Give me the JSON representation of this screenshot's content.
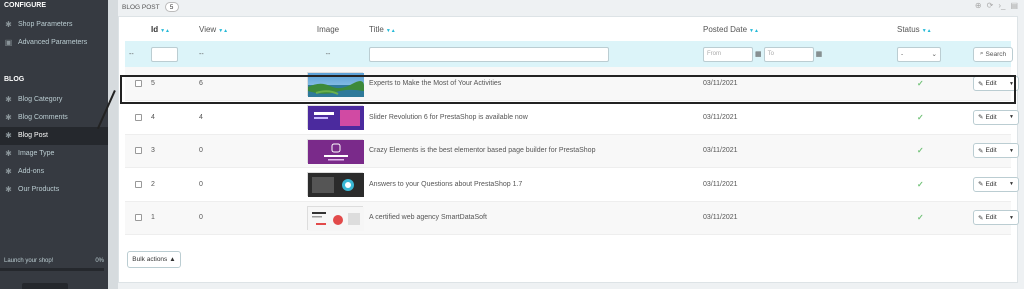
{
  "sidebar": {
    "configure_title": "CONFIGURE",
    "configure_items": [
      {
        "label": "Shop Parameters",
        "icon": "gear-icon"
      },
      {
        "label": "Advanced Parameters",
        "icon": "settings-box-icon"
      }
    ],
    "blog_title": "BLOG",
    "blog_items": [
      {
        "label": "Blog Category",
        "icon": "puzzle-icon"
      },
      {
        "label": "Blog Comments",
        "icon": "puzzle-icon"
      },
      {
        "label": "Blog Post",
        "icon": "puzzle-icon",
        "active": true
      },
      {
        "label": "Image Type",
        "icon": "puzzle-icon"
      },
      {
        "label": "Add-ons",
        "icon": "puzzle-icon"
      },
      {
        "label": "Our Products",
        "icon": "puzzle-icon"
      }
    ],
    "launch_label": "Launch your shop!",
    "launch_progress": "0%"
  },
  "panel": {
    "title": "BLOG POST",
    "count": "5"
  },
  "table": {
    "headers": {
      "id": "Id",
      "view": "View",
      "image": "Image",
      "title": "Title",
      "posted_date": "Posted Date",
      "status": "Status"
    },
    "filters": {
      "dash": "--",
      "date_from_placeholder": "From",
      "date_to_placeholder": "To",
      "status_select": "-",
      "search_label": "Search"
    },
    "rows": [
      {
        "id": "5",
        "view": "6",
        "title": "Experts to Make the Most of Your Activities",
        "date": "03/11/2021",
        "thumb": "landscape"
      },
      {
        "id": "4",
        "view": "4",
        "title": "Slider Revolution 6 for PrestaShop is available now",
        "date": "03/11/2021",
        "thumb": "slider"
      },
      {
        "id": "3",
        "view": "0",
        "title": "Crazy Elements is the best elementor based page builder for PrestaShop",
        "date": "03/11/2021",
        "thumb": "crazy"
      },
      {
        "id": "2",
        "view": "0",
        "title": "Answers to your Questions about PrestaShop 1.7",
        "date": "03/11/2021",
        "thumb": "answers"
      },
      {
        "id": "1",
        "view": "0",
        "title": "A certified web agency SmartDataSoft",
        "date": "03/11/2021",
        "thumb": "agency"
      }
    ],
    "edit_label": "Edit",
    "bulk_label": "Bulk actions"
  },
  "colors": {
    "sidebar_bg": "#363a41",
    "accent": "#25b9d7",
    "status_ok": "#72c279",
    "filter_bg": "#dcf4f9"
  }
}
